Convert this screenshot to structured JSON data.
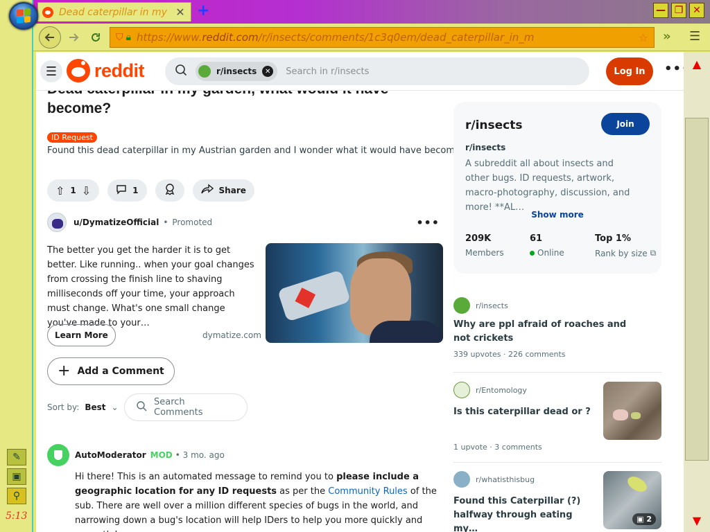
{
  "taskbar": {
    "clock": "5:13"
  },
  "browser": {
    "tab_title": "Dead caterpillar in my",
    "tab_close": "✕",
    "new_tab": "+",
    "url_prefix": "https://www.",
    "url_domain": "reddit.com",
    "url_path": "/r/insects/comments/1c3q0em/dead_caterpillar_in_m",
    "window_min": "—",
    "window_max": "❐",
    "window_close": "✕"
  },
  "reddit": {
    "logo_text": "reddit",
    "search_chip": "r/insects",
    "search_placeholder": "Search in r/insects",
    "login_label": "Log In",
    "more_label": "•••"
  },
  "post": {
    "title": "Dead caterpillar in my garden, what would it have become?",
    "flair": "ID Request",
    "body": "Found this dead caterpillar in my Austrian garden and I wonder what it would have become.",
    "upvotes": "1",
    "comments": "1",
    "share_label": "Share"
  },
  "ad": {
    "user": "u/DymatizeOfficial",
    "promoted": "Promoted",
    "text": "The better you get the harder it is to get better. Like running.. when your goal changes from crossing the finish line to shaving milliseconds off your time, your approach must change. What's one small change you've made to your…",
    "cta": "Learn More",
    "domain": "dymatize.com"
  },
  "comments": {
    "add_label": "Add a Comment",
    "sort_label": "Sort by:",
    "sort_value": "Best",
    "search_placeholder": "Search Comments",
    "first": {
      "author": "AutoModerator",
      "tag": "MOD",
      "time": "• 3 mo. ago",
      "text_1": "Hi there! This is an automated message to remind you to ",
      "text_bold": "please include a geographic location for any ID requests",
      "text_2": " as per the ",
      "link": "Community Rules",
      "text_3": " of the sub. There are well over a million different species of bugs in the world, and narrowing down a bug's location will help IDers to help you more quickly and correctly!"
    }
  },
  "sidebar": {
    "name": "r/insects",
    "join_label": "Join",
    "sub": "r/insects",
    "description": "A subreddit all about insects and other bugs. ID requests, artwork, macro-photography, discussion, and more! **AL…",
    "show_more": "Show more",
    "stats": [
      {
        "value": "209K",
        "label": "Members"
      },
      {
        "value": "61",
        "label": "Online"
      },
      {
        "value": "Top 1%",
        "label": "Rank by size"
      }
    ]
  },
  "related": [
    {
      "sub": "r/insects",
      "title": "Why are ppl afraid of roaches and not crickets",
      "upvotes": "339 upvotes",
      "comments": "226 comments"
    },
    {
      "sub": "r/Entomology",
      "title": "Is this caterpillar dead or ?",
      "upvotes": "1 upvote",
      "comments": "3 comments"
    },
    {
      "sub": "r/whatisthisbug",
      "title": "Found this Caterpillar (?) halfway through eating my…",
      "badge": "2"
    }
  ],
  "colors": {
    "reddit_orange": "#ff4500",
    "join_blue": "#0a449b",
    "mod_green": "#46d160"
  }
}
